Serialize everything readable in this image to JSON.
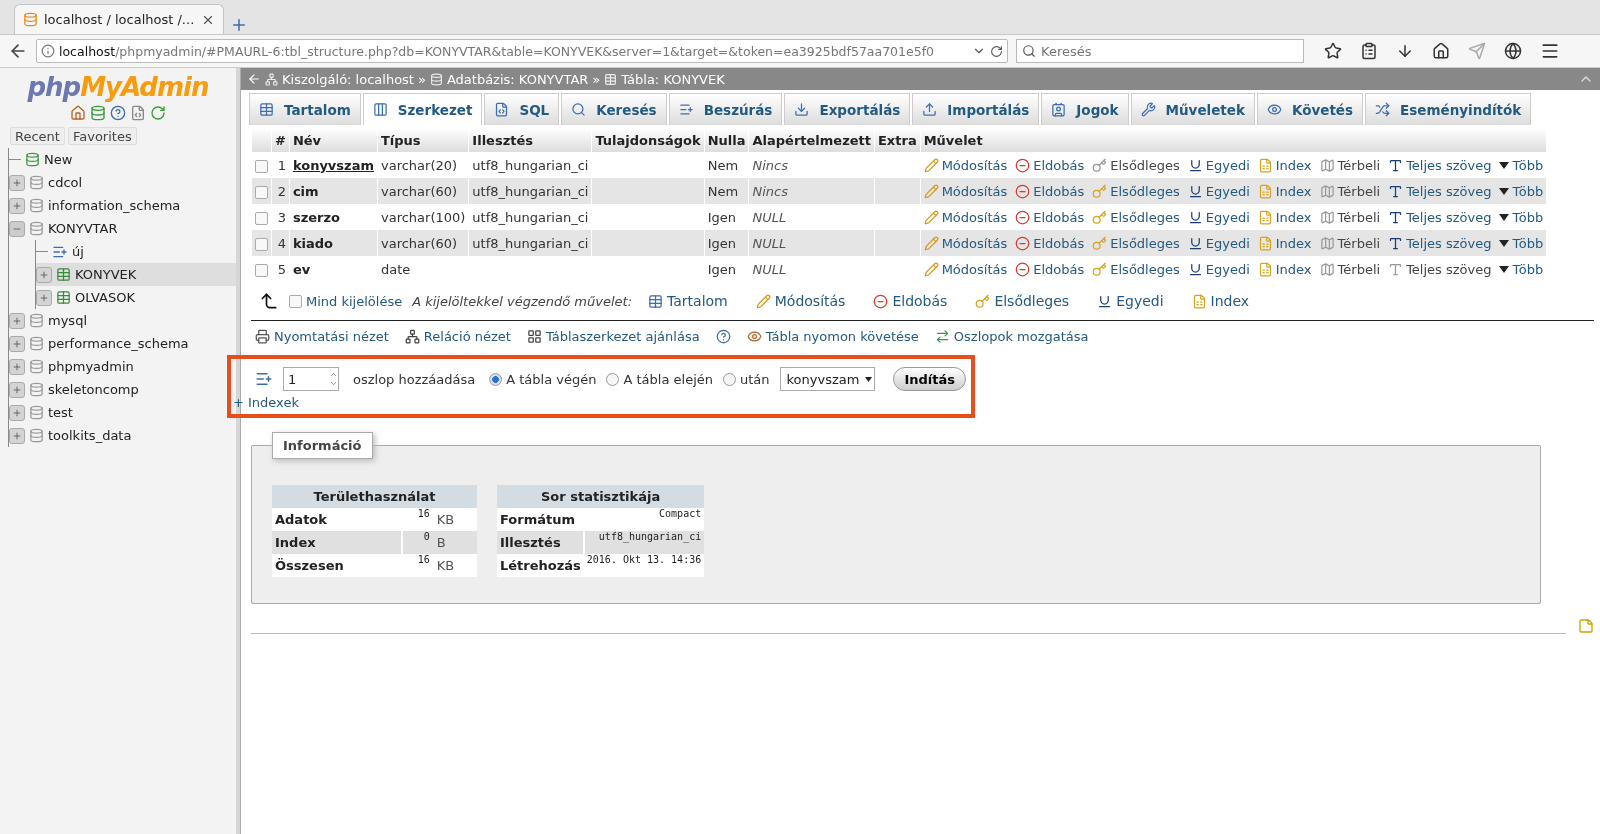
{
  "browser": {
    "tab_title": "localhost / localhost /...",
    "url_host": "localhost",
    "url_path": "/phpmyadmin/#PMAURL-6:tbl_structure.php?db=KONYVTAR&table=KONYVEK&server=1&target=&token=ea3925bdf57aa701e5f0",
    "search_placeholder": "Keresés"
  },
  "sidebar": {
    "logo": {
      "prefix": "php",
      "name": "MyAdmin"
    },
    "tabs": [
      "Recent",
      "Favorites"
    ],
    "tree": [
      {
        "kind": "new",
        "label": "New",
        "selected": false
      },
      {
        "kind": "database",
        "label": "cdcol",
        "expanded": false,
        "selected": false
      },
      {
        "kind": "database",
        "label": "information_schema",
        "expanded": false,
        "selected": false
      },
      {
        "kind": "database",
        "label": "KONYVTAR",
        "expanded": true,
        "selected": false,
        "children": [
          {
            "kind": "new-table",
            "label": "új",
            "selected": false
          },
          {
            "kind": "table",
            "label": "KONYVEK",
            "expanded": false,
            "selected": true
          },
          {
            "kind": "table",
            "label": "OLVASOK",
            "expanded": false,
            "selected": false
          }
        ]
      },
      {
        "kind": "database",
        "label": "mysql",
        "expanded": false,
        "selected": false
      },
      {
        "kind": "database",
        "label": "performance_schema",
        "expanded": false,
        "selected": false
      },
      {
        "kind": "database",
        "label": "phpmyadmin",
        "expanded": false,
        "selected": false
      },
      {
        "kind": "database",
        "label": "skeletoncomp",
        "expanded": false,
        "selected": false
      },
      {
        "kind": "database",
        "label": "test",
        "expanded": false,
        "selected": false
      },
      {
        "kind": "database",
        "label": "toolkits_data",
        "expanded": false,
        "selected": false
      }
    ]
  },
  "breadcrumb": {
    "separator": "»",
    "items": [
      {
        "kind": "server",
        "label": "Kiszolgáló: localhost"
      },
      {
        "kind": "database",
        "label": "Adatbázis: KONYVTAR"
      },
      {
        "kind": "table",
        "label": "Tábla: KONYVEK"
      }
    ]
  },
  "tabs": [
    {
      "kind": "browse",
      "label": "Tartalom",
      "selected": false
    },
    {
      "kind": "structure",
      "label": "Szerkezet",
      "selected": true
    },
    {
      "kind": "sql",
      "label": "SQL",
      "selected": false
    },
    {
      "kind": "search",
      "label": "Keresés",
      "selected": false
    },
    {
      "kind": "insert",
      "label": "Beszúrás",
      "selected": false
    },
    {
      "kind": "export",
      "label": "Exportálás",
      "selected": false
    },
    {
      "kind": "import",
      "label": "Importálás",
      "selected": false
    },
    {
      "kind": "privileges",
      "label": "Jogok",
      "selected": false
    },
    {
      "kind": "operations",
      "label": "Műveletek",
      "selected": false
    },
    {
      "kind": "tracking",
      "label": "Követés",
      "selected": false
    },
    {
      "kind": "triggers",
      "label": "Eseményindítók",
      "selected": false
    }
  ],
  "table": {
    "columns": [
      "#",
      "Név",
      "Típus",
      "Illesztés",
      "Tulajdonságok",
      "Nulla",
      "Alapértelmezett",
      "Extra",
      "Művelet"
    ],
    "rows": [
      {
        "checked": false,
        "number": "1",
        "name": "konyvszam",
        "primary": true,
        "type": "varchar(20)",
        "collation": "utf8_hungarian_ci",
        "null": "Nem",
        "default": "Nincs",
        "actions": [
          {
            "kind": "change",
            "label": "Módosítás",
            "disabled": false
          },
          {
            "kind": "drop",
            "label": "Eldobás",
            "disabled": false
          },
          {
            "kind": "primary",
            "label": "Elsődleges",
            "disabled": true
          },
          {
            "kind": "unique",
            "label": "Egyedi",
            "disabled": false
          },
          {
            "kind": "index",
            "label": "Index",
            "disabled": false
          },
          {
            "kind": "spatial",
            "label": "Térbeli",
            "disabled": true
          },
          {
            "kind": "fulltext",
            "label": "Teljes szöveg",
            "disabled": false
          },
          {
            "kind": "more",
            "label": "Több",
            "disabled": false
          }
        ]
      },
      {
        "checked": false,
        "number": "2",
        "name": "cim",
        "primary": false,
        "type": "varchar(60)",
        "collation": "utf8_hungarian_ci",
        "null": "Nem",
        "default": "Nincs",
        "actions": [
          {
            "kind": "change",
            "label": "Módosítás",
            "disabled": false
          },
          {
            "kind": "drop",
            "label": "Eldobás",
            "disabled": false
          },
          {
            "kind": "primary",
            "label": "Elsődleges",
            "disabled": false
          },
          {
            "kind": "unique",
            "label": "Egyedi",
            "disabled": false
          },
          {
            "kind": "index",
            "label": "Index",
            "disabled": false
          },
          {
            "kind": "spatial",
            "label": "Térbeli",
            "disabled": true
          },
          {
            "kind": "fulltext",
            "label": "Teljes szöveg",
            "disabled": false
          },
          {
            "kind": "more",
            "label": "Több",
            "disabled": false
          }
        ]
      },
      {
        "checked": false,
        "number": "3",
        "name": "szerzo",
        "primary": false,
        "type": "varchar(100)",
        "collation": "utf8_hungarian_ci",
        "null": "Igen",
        "default": "NULL",
        "actions": [
          {
            "kind": "change",
            "label": "Módosítás",
            "disabled": false
          },
          {
            "kind": "drop",
            "label": "Eldobás",
            "disabled": false
          },
          {
            "kind": "primary",
            "label": "Elsődleges",
            "disabled": false
          },
          {
            "kind": "unique",
            "label": "Egyedi",
            "disabled": false
          },
          {
            "kind": "index",
            "label": "Index",
            "disabled": false
          },
          {
            "kind": "spatial",
            "label": "Térbeli",
            "disabled": true
          },
          {
            "kind": "fulltext",
            "label": "Teljes szöveg",
            "disabled": false
          },
          {
            "kind": "more",
            "label": "Több",
            "disabled": false
          }
        ]
      },
      {
        "checked": false,
        "number": "4",
        "name": "kiado",
        "primary": false,
        "type": "varchar(60)",
        "collation": "utf8_hungarian_ci",
        "null": "Igen",
        "default": "NULL",
        "actions": [
          {
            "kind": "change",
            "label": "Módosítás",
            "disabled": false
          },
          {
            "kind": "drop",
            "label": "Eldobás",
            "disabled": false
          },
          {
            "kind": "primary",
            "label": "Elsődleges",
            "disabled": false
          },
          {
            "kind": "unique",
            "label": "Egyedi",
            "disabled": false
          },
          {
            "kind": "index",
            "label": "Index",
            "disabled": false
          },
          {
            "kind": "spatial",
            "label": "Térbeli",
            "disabled": true
          },
          {
            "kind": "fulltext",
            "label": "Teljes szöveg",
            "disabled": false
          },
          {
            "kind": "more",
            "label": "Több",
            "disabled": false
          }
        ]
      },
      {
        "checked": false,
        "number": "5",
        "name": "ev",
        "primary": false,
        "type": "date",
        "null": "Igen",
        "default": "NULL",
        "actions": [
          {
            "kind": "change",
            "label": "Módosítás",
            "disabled": false
          },
          {
            "kind": "drop",
            "label": "Eldobás",
            "disabled": false
          },
          {
            "kind": "primary",
            "label": "Elsődleges",
            "disabled": false
          },
          {
            "kind": "unique",
            "label": "Egyedi",
            "disabled": false
          },
          {
            "kind": "index",
            "label": "Index",
            "disabled": false
          },
          {
            "kind": "spatial",
            "label": "Térbeli",
            "disabled": true
          },
          {
            "kind": "fulltext",
            "label": "Teljes szöveg",
            "disabled": true
          },
          {
            "kind": "more",
            "label": "Több",
            "disabled": false
          }
        ]
      }
    ]
  },
  "bulk": {
    "select_all": {
      "label": "Mind kijelölése",
      "checked": false
    },
    "caption": "A kijelöltekkel végzendő művelet:",
    "actions": [
      {
        "kind": "browse",
        "label": "Tartalom"
      },
      {
        "kind": "change",
        "label": "Módosítás"
      },
      {
        "kind": "drop",
        "label": "Eldobás"
      },
      {
        "kind": "primary",
        "label": "Elsődleges"
      },
      {
        "kind": "unique",
        "label": "Egyedi"
      },
      {
        "kind": "index",
        "label": "Index"
      }
    ]
  },
  "links": [
    {
      "kind": "print",
      "label": "Nyomtatási nézet"
    },
    {
      "kind": "relation",
      "label": "Reláció nézet"
    },
    {
      "kind": "propose",
      "label": "Táblaszerkezet ajánlása"
    },
    {
      "kind": "help"
    },
    {
      "kind": "track",
      "label": "Tábla nyomon követése"
    },
    {
      "kind": "move",
      "label": "Oszlopok mozgatása"
    }
  ],
  "add_column": {
    "count": "1",
    "label": "oszlop hozzáadása",
    "positions": [
      {
        "label": "A tábla végén",
        "selected": true
      },
      {
        "label": "A tábla elején",
        "selected": false
      },
      {
        "label": "után",
        "selected": false
      }
    ],
    "after_column": "konyvszam",
    "button": "Indítás",
    "indexes_link": "+ Indexek"
  },
  "info": {
    "legend": "Információ",
    "space_usage": {
      "title": "Területhasználat",
      "rows": [
        {
          "label": "Adatok",
          "value": "16",
          "unit": "KB"
        },
        {
          "label": "Index",
          "value": "0",
          "unit": "B"
        },
        {
          "label": "Összesen",
          "value": "16",
          "unit": "KB"
        }
      ]
    },
    "row_stats": {
      "title": "Sor statisztikája",
      "rows": [
        {
          "label": "Formátum",
          "value": "Compact"
        },
        {
          "label": "Illesztés",
          "value": "utf8_hungarian_ci"
        },
        {
          "label": "Létrehozás",
          "value": "2016. Okt 13. 14:36"
        }
      ]
    }
  }
}
